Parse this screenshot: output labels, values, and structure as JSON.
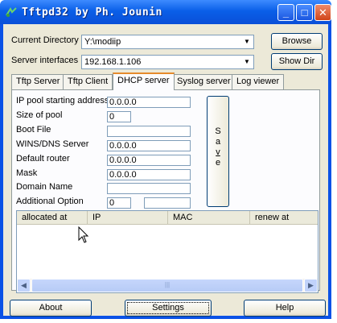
{
  "window": {
    "title": "Tftpd32 by Ph. Jounin",
    "controls": {
      "minimize": "_",
      "maximize": "□",
      "close": "✕"
    }
  },
  "header": {
    "current_directory_label": "Current Directory",
    "current_directory_value": "Y:\\modiip",
    "server_interfaces_label": "Server interfaces",
    "server_interfaces_value": "192.168.1.106",
    "browse_label": "Browse",
    "show_dir_label": "Show Dir"
  },
  "tabs": [
    {
      "label": "Tftp Server",
      "active": false
    },
    {
      "label": "Tftp Client",
      "active": false
    },
    {
      "label": "DHCP server",
      "active": true
    },
    {
      "label": "Syslog server",
      "active": false
    },
    {
      "label": "Log viewer",
      "active": false
    }
  ],
  "dhcp": {
    "fields": [
      {
        "label": "IP pool starting address",
        "value": "0.0.0.0"
      },
      {
        "label": "Size of pool",
        "value": "0"
      },
      {
        "label": "Boot File",
        "value": ""
      },
      {
        "label": "WINS/DNS Server",
        "value": "0.0.0.0"
      },
      {
        "label": "Default router",
        "value": "0.0.0.0"
      },
      {
        "label": "Mask",
        "value": "0.0.0.0"
      },
      {
        "label": "Domain Name",
        "value": ""
      },
      {
        "label": "Additional Option",
        "value": "0",
        "value2": ""
      }
    ],
    "save_letters": [
      "S",
      "a",
      "v",
      "e"
    ]
  },
  "leases": {
    "columns": [
      "allocated at",
      "IP",
      "MAC",
      "renew at"
    ],
    "rows": []
  },
  "footer": {
    "about_label": "About",
    "settings_label": "Settings",
    "help_label": "Help"
  },
  "colors": {
    "titlebar": "#0a5fe8",
    "client_bg": "#ece9d8",
    "active_tab_accent": "#e68b2c"
  }
}
